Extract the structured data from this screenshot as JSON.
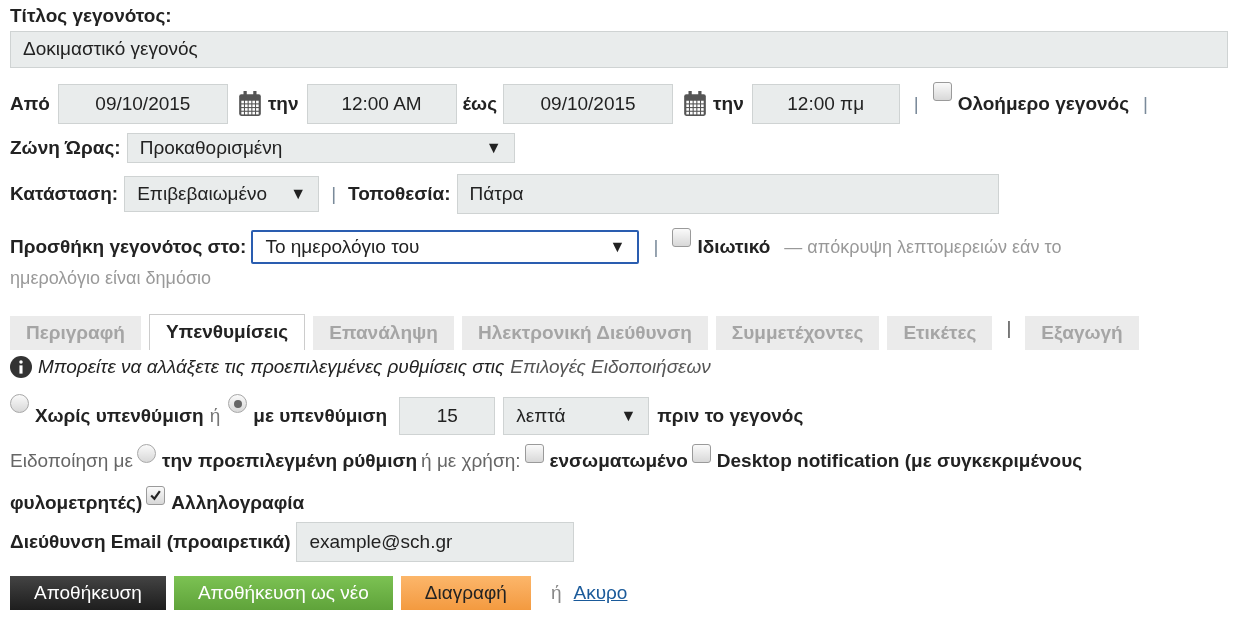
{
  "title": {
    "label": "Τίτλος γεγονότος:",
    "value": "Δοκιμαστικό γεγονός"
  },
  "dates": {
    "from_label": "Από",
    "start_date": "09/10/2015",
    "start_at_label": "την",
    "start_time": "12:00 AM",
    "to_label": "έως",
    "end_date": "09/10/2015",
    "end_at_label": "την",
    "end_time": "12:00 πμ",
    "separator_1": "|",
    "all_day": {
      "label": "Ολοήμερο γεγονός",
      "checked": false
    },
    "separator_2": "|"
  },
  "timezone": {
    "label": "Ζώνη Ώρας:",
    "value": "Προκαθορισμένη",
    "arrow": "▼"
  },
  "status": {
    "label": "Κατάσταση:",
    "value": "Επιβεβαιωμένο",
    "arrow": "▼",
    "separator": "|"
  },
  "location": {
    "label": "Τοποθεσία:",
    "value": "Πάτρα"
  },
  "calendar": {
    "label": "Προσθήκη γεγονότος στο:",
    "value": "Το ημερολόγιο του",
    "arrow": "▼",
    "separator": "|"
  },
  "private": {
    "label": "Ιδιωτικό",
    "checked": false,
    "note_line_1": "— απόκρυψη λεπτομερειών εάν το",
    "note_line_2": "ημερολόγιο είναι δημόσιο"
  },
  "tabs": [
    {
      "label": "Περιγραφή",
      "selected": false,
      "kind": "tab"
    },
    {
      "label": "Υπενθυμίσεις",
      "selected": true,
      "kind": "tab"
    },
    {
      "label": "Επανάληψη",
      "selected": false,
      "kind": "tab"
    },
    {
      "label": "Ηλεκτρονική Διεύθυνση",
      "selected": false,
      "kind": "tab"
    },
    {
      "label": "Συμμετέχοντες",
      "selected": false,
      "kind": "tab"
    },
    {
      "label": "Ετικέτες",
      "selected": false,
      "kind": "tab"
    },
    {
      "label": "|",
      "kind": "separator"
    },
    {
      "label": "Εξαγωγή",
      "selected": false,
      "kind": "tab"
    }
  ],
  "info": {
    "text": "Μπορείτε να αλλάξετε τις προεπιλεγμένες ρυθμίσεις στις",
    "link": "Επιλογές Ειδοποιήσεων"
  },
  "reminder": [
    {
      "kind": "radio",
      "label": "Χωρίς υπενθύμιση",
      "selected": false
    },
    {
      "kind": "text",
      "text": "ή"
    },
    {
      "kind": "radio",
      "label": "με υπενθύμιση",
      "selected": true
    },
    {
      "kind": "field",
      "value": "15"
    },
    {
      "kind": "select",
      "value": "λεπτά",
      "arrow": "▼"
    },
    {
      "kind": "label",
      "text": "πριν το γεγονός"
    }
  ],
  "notify": [
    [
      {
        "kind": "text",
        "text": "Ειδοποίηση με"
      },
      {
        "kind": "radio",
        "label": "την προεπιλεγμένη ρύθμιση",
        "selected": false
      },
      {
        "kind": "text",
        "text": "ή με χρήση:"
      },
      {
        "kind": "checkbox",
        "label": "ενσωματωμένο",
        "checked": false
      },
      {
        "kind": "checkbox",
        "label": "Desktop notification (με συγκεκριμένους",
        "checked": false
      }
    ],
    [
      {
        "kind": "label",
        "text": "φυλομετρητές)"
      },
      {
        "kind": "checkbox",
        "label": "Αλληλογραφία",
        "checked": true
      }
    ]
  ],
  "email": {
    "label": "Διεύθυνση Email (προαιρετικά)",
    "value": "example@sch.gr"
  },
  "actions": [
    {
      "kind": "dark",
      "label": "Αποθήκευση"
    },
    {
      "kind": "green",
      "label": "Αποθήκευση ως νέο"
    },
    {
      "kind": "orange",
      "label": "Διαγραφή"
    },
    {
      "kind": "text",
      "label": "ή"
    },
    {
      "kind": "link",
      "label": "Ακυρο"
    }
  ]
}
